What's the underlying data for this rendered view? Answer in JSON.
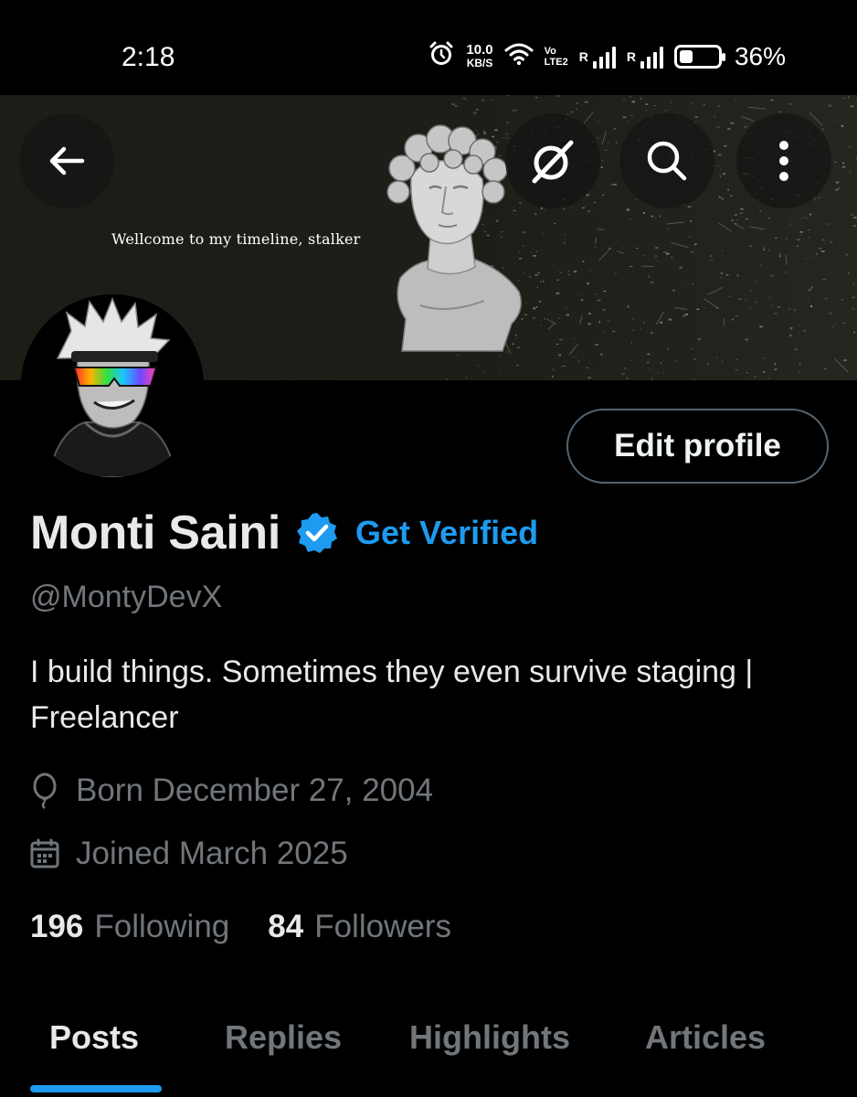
{
  "status_bar": {
    "time": "2:18",
    "speed_value": "10.0",
    "speed_unit": "KB/S",
    "volte_top": "Vo",
    "volte_bottom": "LTE2",
    "sim1_label": "R",
    "sim2_label": "R",
    "battery_percent": "36%",
    "battery_level": 0.36
  },
  "banner": {
    "caption": "Wellcome to my timeline, stalker"
  },
  "profile": {
    "name": "Monti Saini",
    "get_verified": "Get Verified",
    "handle": "@MontyDevX",
    "bio": "I build things. Sometimes they even survive staging | Freelancer",
    "born": "Born December 27, 2004",
    "joined": "Joined March 2025",
    "following_count": "196",
    "following_label": "Following",
    "followers_count": "84",
    "followers_label": "Followers",
    "edit_profile": "Edit profile"
  },
  "tabs": [
    "Posts",
    "Replies",
    "Highlights",
    "Articles"
  ],
  "active_tab": "Posts",
  "colors": {
    "accent": "#1d9bf0",
    "background": "#000000",
    "text_primary": "#e7e9ea",
    "text_secondary": "#71767b",
    "border": "#536471"
  }
}
